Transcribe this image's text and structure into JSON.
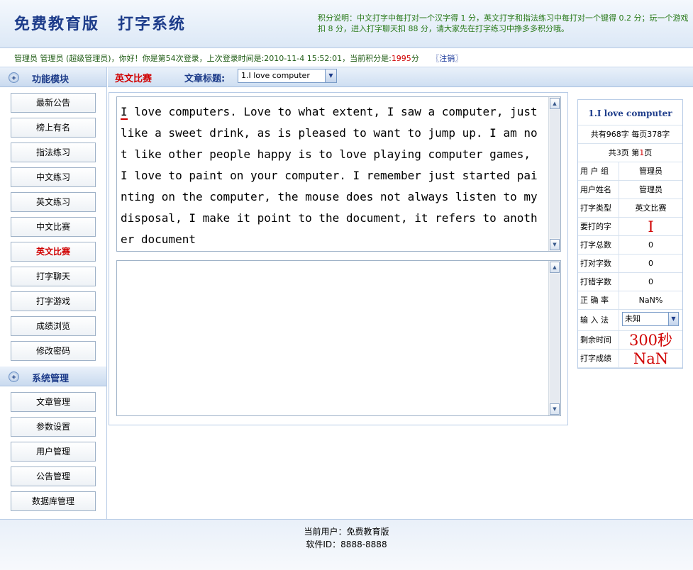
{
  "header": {
    "title_part1": "免费教育版",
    "title_part2": "打字系统",
    "score_note": "积分说明：中文打字中每打对一个汉字得 1 分，英文打字和指法练习中每打对一个键得 0.2 分；玩一个游戏扣 8 分，进入打字聊天扣 88 分，请大家先在打字练习中挣多多积分哦。"
  },
  "welcome": {
    "text_before": "管理员 管理员 (超级管理员)，你好！你是第54次登录，上次登录时间是:2010-11-4 15:52:01，当前积分是:",
    "points": "1995",
    "points_unit": "分",
    "logout": "〖注销〗"
  },
  "sidebar": {
    "section1_title": "功能模块",
    "section1_items": [
      "最新公告",
      "榜上有名",
      "指法练习",
      "中文练习",
      "英文练习",
      "中文比赛",
      "英文比赛",
      "打字聊天",
      "打字游戏",
      "成绩浏览",
      "修改密码"
    ],
    "active_item": "英文比赛",
    "section2_title": "系统管理",
    "section2_items": [
      "文章管理",
      "参数设置",
      "用户管理",
      "公告管理",
      "数据库管理"
    ]
  },
  "toolbar": {
    "mode": "英文比赛",
    "article_label": "文章标题:",
    "article_selected": "1.I love computer"
  },
  "article": {
    "first_char": "I",
    "rest": " love computers. Love to what extent, I saw a computer, just like a sweet drink, as is pleased to want to jump up. I am not like other people happy is to love playing computer games, I love to paint on your computer. I remember just started painting on the computer, the mouse does not always listen to my disposal, I make it point to the document, it refers to another document"
  },
  "info": {
    "title": "1.I love computer",
    "chars_total_line": "共有968字 每页378字",
    "pages_prefix": "共3页 第",
    "page_current": "1",
    "pages_suffix": "页",
    "rows": [
      {
        "label": "用 户 组",
        "value": "管理员"
      },
      {
        "label": "用户姓名",
        "value": "管理员"
      },
      {
        "label": "打字类型",
        "value": "英文比赛"
      }
    ],
    "next_char_label": "要打的字",
    "next_char": "I",
    "stats": [
      {
        "label": "打字总数",
        "value": "0"
      },
      {
        "label": "打对字数",
        "value": "0"
      },
      {
        "label": "打错字数",
        "value": "0"
      },
      {
        "label": "正 确 率",
        "value": "NaN%"
      }
    ],
    "ime_label": "输 入 法",
    "ime_value": "未知",
    "time_label": "剩余时间",
    "time_value": "300秒",
    "score_label": "打字成绩",
    "score_value": "NaN"
  },
  "footer": {
    "user_line": "当前用户：免费教育版",
    "id_line": "软件ID：8888-8888"
  },
  "colors": {
    "accent_red": "#d00000",
    "title_blue": "#1d3c8a",
    "note_green": "#2a7a1a"
  }
}
